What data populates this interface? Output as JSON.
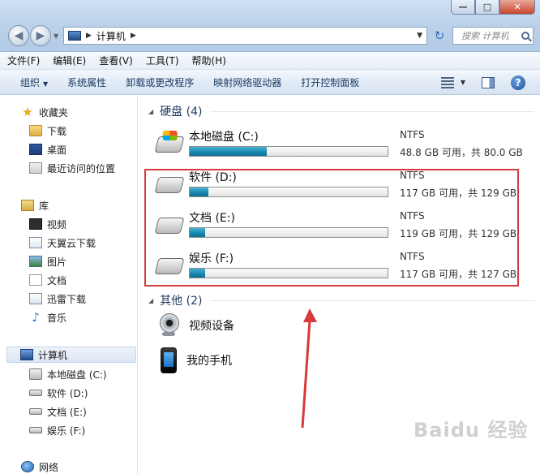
{
  "window": {
    "controls": [
      "minimize",
      "maximize",
      "close"
    ]
  },
  "address": {
    "path": "计算机",
    "search_placeholder": "搜索 计算机"
  },
  "menubar": [
    "文件(F)",
    "编辑(E)",
    "查看(V)",
    "工具(T)",
    "帮助(H)"
  ],
  "toolbar": {
    "organize": "组织",
    "system_properties": "系统属性",
    "uninstall_programs": "卸载或更改程序",
    "map_drive": "映射网络驱动器",
    "open_control_panel": "打开控制面板"
  },
  "sidebar": {
    "favorites": "收藏夹",
    "downloads": "下载",
    "desktop": "桌面",
    "recent": "最近访问的位置",
    "libraries": "库",
    "videos": "视频",
    "tianyi": "天翼云下载",
    "pictures": "图片",
    "documents": "文档",
    "xunlei": "迅雷下载",
    "music": "音乐",
    "computer": "计算机",
    "drive_c": "本地磁盘 (C:)",
    "drive_d": "软件 (D:)",
    "drive_e": "文档 (E:)",
    "drive_f": "娱乐 (F:)",
    "network": "网络"
  },
  "groups": {
    "hard_disks": "硬盘 (4)",
    "other": "其他 (2)"
  },
  "drives": [
    {
      "name": "本地磁盘 (C:)",
      "fs": "NTFS",
      "space": "48.8 GB 可用，共 80.0 GB",
      "used_fraction": 0.39
    },
    {
      "name": "软件 (D:)",
      "fs": "NTFS",
      "space": "117 GB 可用，共 129 GB",
      "used_fraction": 0.093
    },
    {
      "name": "文档 (E:)",
      "fs": "NTFS",
      "space": "119 GB 可用，共 129 GB",
      "used_fraction": 0.078
    },
    {
      "name": "娱乐 (F:)",
      "fs": "NTFS",
      "space": "117 GB 可用，共 127 GB",
      "used_fraction": 0.079
    }
  ],
  "other_devices": [
    "视频设备",
    "我的手机"
  ],
  "annotation": {
    "color": "#d63a3a"
  },
  "watermark": "Baidu 经验",
  "colors": {
    "bar_fill": "#1a89b2",
    "accent_blue": "#1e3a5f"
  }
}
